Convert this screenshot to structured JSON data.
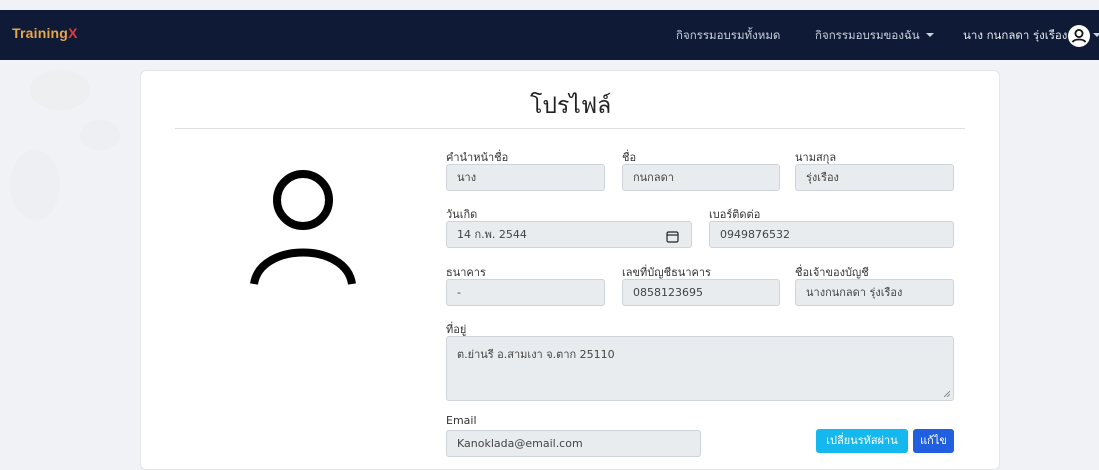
{
  "navbar": {
    "brand_main": "Training",
    "brand_accent": "X",
    "all_activities": "กิจกรรมอบรมทั้งหมด",
    "my_activities": "กิจกรรมอบรมของฉัน",
    "user_name": "นาง กนกลดา รุ่งเรือง"
  },
  "page": {
    "title": "โปรไฟล์"
  },
  "form": {
    "prefix_label": "คำนำหน้าชื่อ",
    "prefix_value": "นาง",
    "first_name_label": "ชื่อ",
    "first_name_value": "กนกลดา",
    "last_name_label": "นามสกุล",
    "last_name_value": "รุ่งเรือง",
    "birthdate_label": "วันเกิด",
    "birthdate_value": "14 ก.พ. 2544",
    "phone_label": "เบอร์ติดต่อ",
    "phone_value": "0949876532",
    "bank_label": "ธนาคาร",
    "bank_value": "-",
    "account_no_label": "เลขที่บัญชีธนาคาร",
    "account_no_value": "0858123695",
    "account_owner_label": "ชื่อเจ้าของบัญชี",
    "account_owner_value": "นางกนกลดา รุ่งเรือง",
    "address_label": "ที่อยู่",
    "address_value": "ต.ย่านรี อ.สามเงา จ.ตาก 25110",
    "email_label": "Email",
    "email_value": "Kanoklada@email.com"
  },
  "buttons": {
    "change_password": "เปลี่ยนรหัสผ่าน",
    "edit": "แก้ไข"
  },
  "colors": {
    "navbar": "#0e1a36",
    "brand": "#e8a54a",
    "brand_accent": "#e23a3a",
    "btn_info": "#14b8ef",
    "btn_primary": "#1f5fe0"
  },
  "icons": {
    "avatar": "user-icon",
    "calendar": "calendar-icon"
  }
}
